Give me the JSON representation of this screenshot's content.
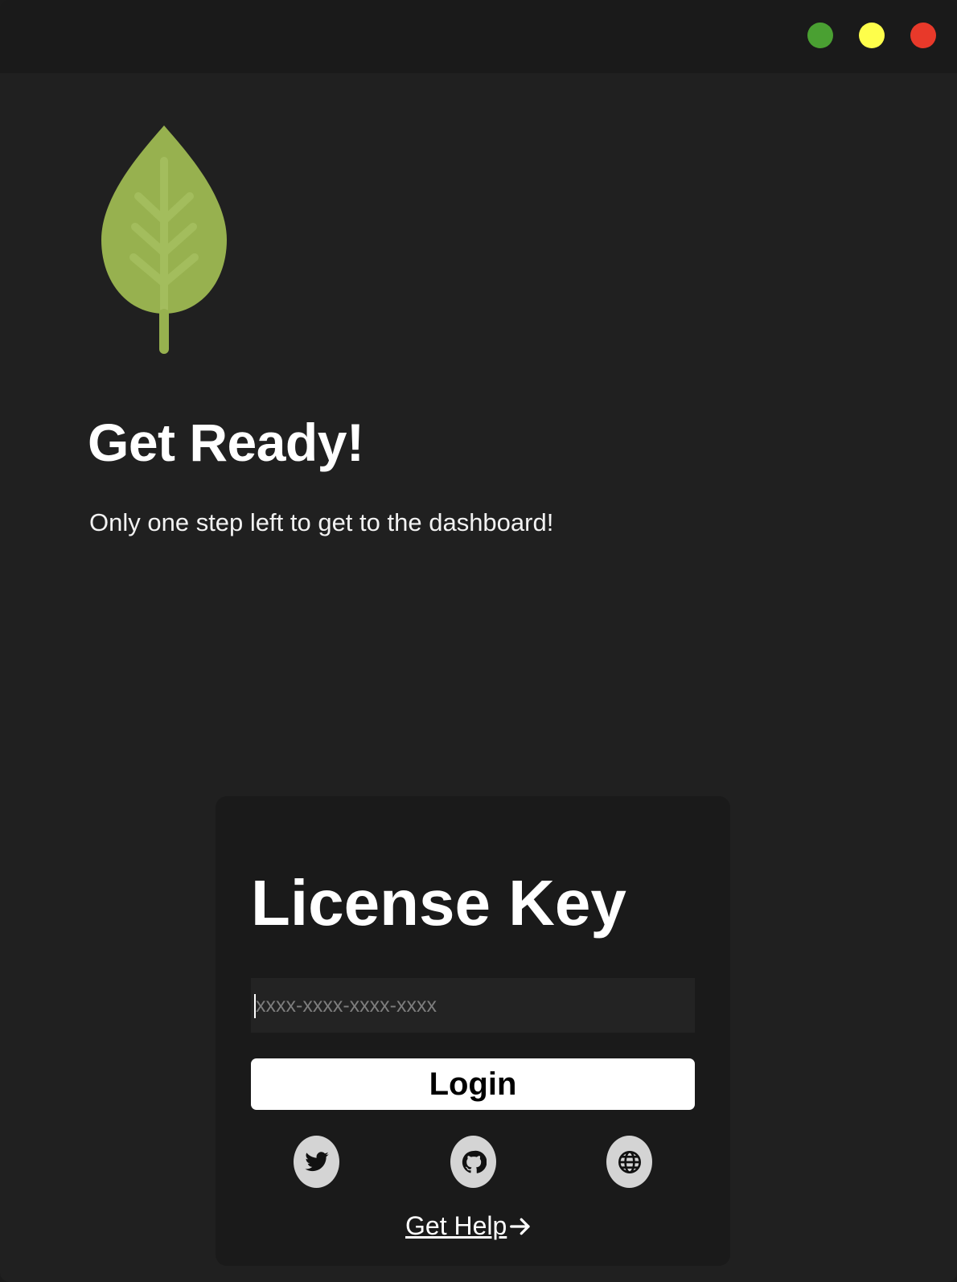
{
  "window": {
    "controls": [
      "maximize",
      "minimize",
      "close"
    ]
  },
  "intro": {
    "title": "Get Ready!",
    "subtitle": "Only one step left to get to the dashboard!",
    "logo_icon": "leaf-icon",
    "logo_color": "#97b14f"
  },
  "license": {
    "title": "License Key",
    "input_value": "",
    "input_placeholder": "xxxx-xxxx-xxxx-xxxx",
    "login_label": "Login",
    "help_label": "Get Help",
    "social": [
      "twitter-icon",
      "github-icon",
      "globe-icon"
    ]
  },
  "colors": {
    "background": "#202020",
    "card": "#1a1a1a",
    "green": "#4aa032",
    "yellow": "#fefe4b",
    "red": "#e8392a"
  }
}
